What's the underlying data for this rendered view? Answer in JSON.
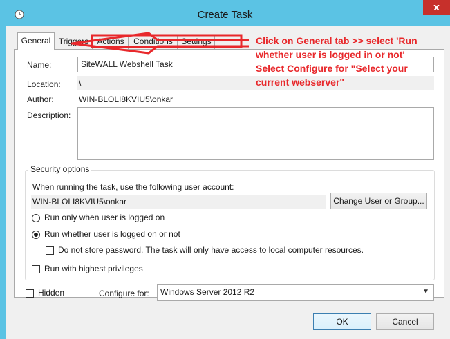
{
  "window": {
    "title": "Create Task",
    "close_glyph": "x"
  },
  "tabs": [
    {
      "label": "General",
      "active": true
    },
    {
      "label": "Triggers",
      "active": false
    },
    {
      "label": "Actions",
      "active": false
    },
    {
      "label": "Conditions",
      "active": false
    },
    {
      "label": "Settings",
      "active": false
    }
  ],
  "general": {
    "name_label": "Name:",
    "name_value": "SiteWALL Webshell Task",
    "location_label": "Location:",
    "location_value": "\\",
    "author_label": "Author:",
    "author_value": "WIN-BLOLI8KVIU5\\onkar",
    "description_label": "Description:",
    "description_value": ""
  },
  "security": {
    "group_label": "Security options",
    "account_prompt": "When running the task, use the following user account:",
    "account_value": "WIN-BLOLI8KVIU5\\onkar",
    "change_button": "Change User or Group...",
    "radio_logged_on": "Run only when user is logged on",
    "radio_whether": "Run whether user is logged on or not",
    "checkbox_no_store": "Do not store password.  The task will only have access to local computer resources.",
    "checkbox_highest": "Run with highest privileges"
  },
  "footer": {
    "hidden_label": "Hidden",
    "configure_label": "Configure for:",
    "configure_value": "Windows Server 2012 R2",
    "ok_button": "OK",
    "cancel_button": "Cancel"
  },
  "annotation": {
    "line1": "Click on General tab >> select 'Run",
    "line2": "whether user is logged in or not'",
    "line3": "Select Configure for \"Select your",
    "line4": "current webserver\"",
    "color": "#e8282b"
  },
  "colors": {
    "titlebar": "#5bc3e4",
    "close": "#c7302b",
    "annotation": "#e8282b"
  }
}
